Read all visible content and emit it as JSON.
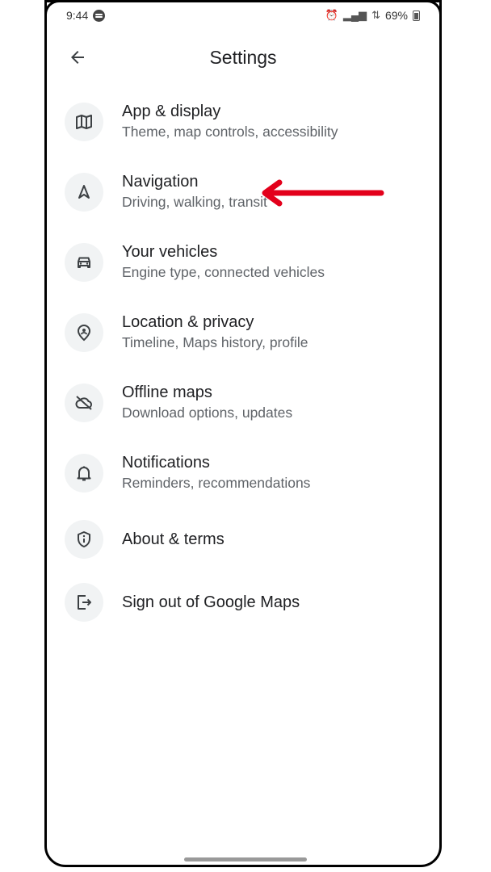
{
  "status_bar": {
    "time": "9:44",
    "battery": "69%"
  },
  "header": {
    "title": "Settings",
    "back_icon": "arrow-back-icon"
  },
  "settings": [
    {
      "icon": "map-icon",
      "title": "App & display",
      "subtitle": "Theme, map controls, accessibility"
    },
    {
      "icon": "navigation-icon",
      "title": "Navigation",
      "subtitle": "Driving, walking, transit"
    },
    {
      "icon": "car-icon",
      "title": "Your vehicles",
      "subtitle": "Engine type, connected vehicles"
    },
    {
      "icon": "location-privacy-icon",
      "title": "Location & privacy",
      "subtitle": "Timeline, Maps history, profile"
    },
    {
      "icon": "cloud-off-icon",
      "title": "Offline maps",
      "subtitle": "Download options, updates"
    },
    {
      "icon": "bell-icon",
      "title": "Notifications",
      "subtitle": "Reminders, recommendations"
    },
    {
      "icon": "shield-info-icon",
      "title": "About & terms",
      "subtitle": ""
    },
    {
      "icon": "logout-icon",
      "title": "Sign out of Google Maps",
      "subtitle": ""
    }
  ],
  "colors": {
    "annotation_arrow": "#e3001b",
    "icon_bg": "#f1f3f4",
    "title_text": "#202124",
    "subtitle_text": "#5f6368"
  }
}
